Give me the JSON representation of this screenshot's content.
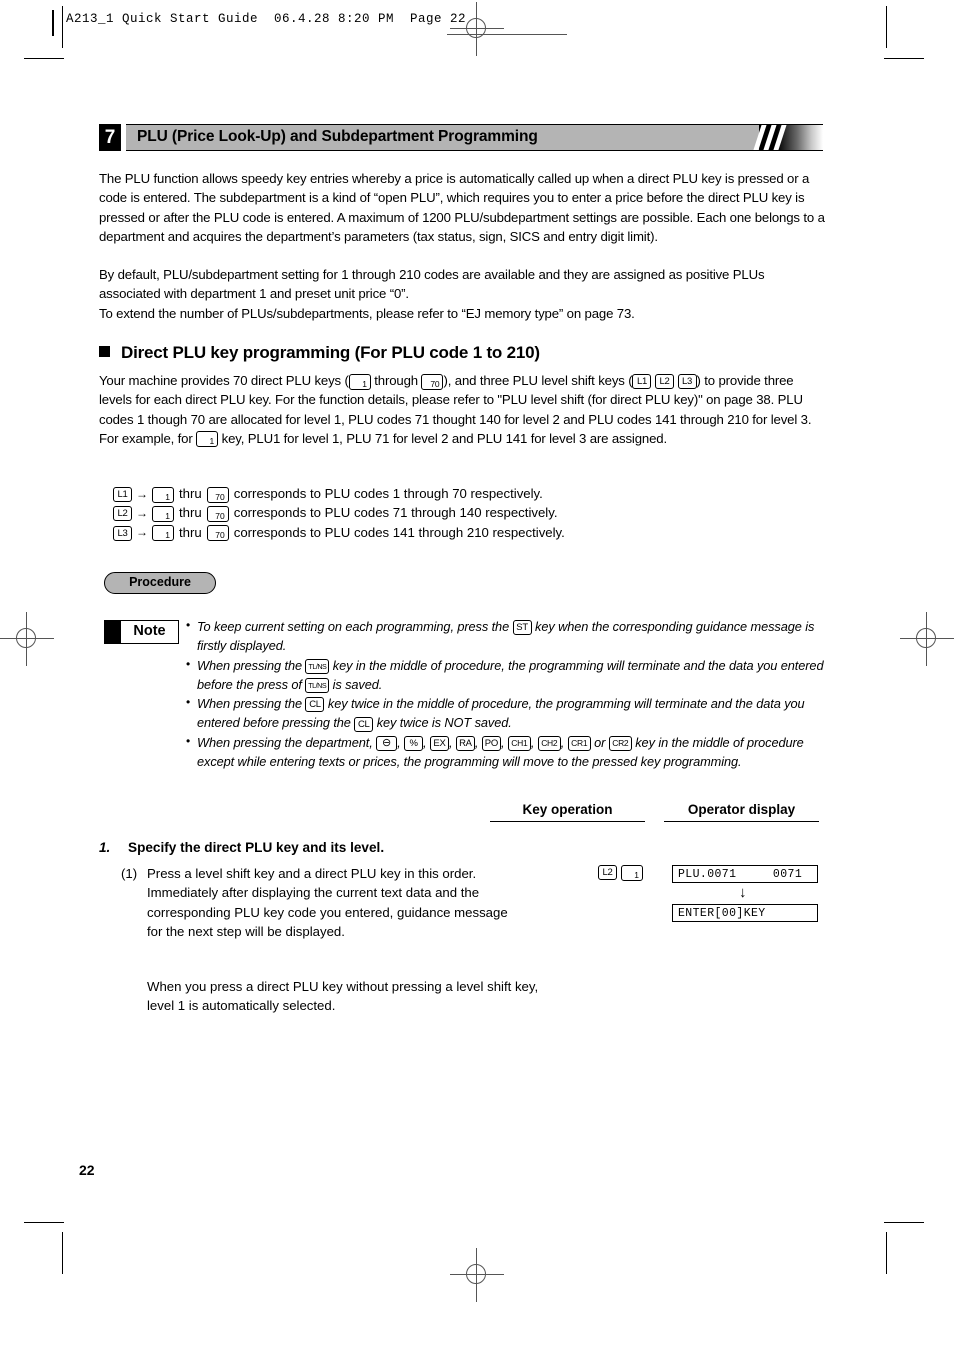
{
  "page_header": {
    "text": "A213_1 Quick Start Guide  06.4.28 8:20 PM  Page 22"
  },
  "section": {
    "number": "7",
    "title": "PLU (Price Look-Up) and Subdepartment Programming"
  },
  "intro": {
    "paragraph1": "The PLU function allows speedy key entries whereby a price is automatically called up when a direct PLU key is pressed or a code is entered.  The subdepartment is a kind of “open PLU”, which requires you to enter a price before the direct PLU key is pressed or after the PLU code is entered.  A maximum of 1200 PLU/subdepartment settings are possible. Each one belongs to a department and acquires the department’s parameters (tax status, sign, SICS and entry digit limit).",
    "paragraph2": "By default, PLU/subdepartment setting for 1 through 210 codes are available and they are assigned as positive PLUs associated with department 1 and preset unit price “0”.",
    "paragraph3": "To extend the number of PLUs/subdepartments, please refer to “EJ memory type” on page 73."
  },
  "subsection": {
    "heading": "Direct PLU key programming (For PLU code 1 to 210)",
    "body_1": "Your machine provides 70 direct PLU keys (",
    "body_2": " through ",
    "body_3": "), and three PLU level shift keys (",
    "body_4": ") to provide three levels for each direct PLU key.  For the function details, please refer to \"PLU level shift (for direct PLU key)\" on page 38.  PLU codes 1 though 70 are allocated for level 1, PLU codes 71 thought 140 for level 2 and PLU codes 141 through 210 for level 3.  For example, for ",
    "body_5": " key, PLU1 for level 1, PLU 71 for level 2 and PLU 141 for level 3 are assigned."
  },
  "keys": {
    "plu_1": "1",
    "plu_70": "70",
    "l1": "L1",
    "l2": "L2",
    "l3": "L3",
    "st": "ST",
    "tlns": "TL/NS",
    "cl": "CL",
    "minus": "⊖",
    "percent": "%",
    "ex": "EX",
    "ra": "RA",
    "po": "PO",
    "ch1": "CH1",
    "ch2": "CH2",
    "cr1": "CR1",
    "cr2": "CR2",
    "arrow": "→"
  },
  "level_rows": [
    {
      "shift": "L1",
      "from": "1",
      "thru_label": "thru",
      "to": "70",
      "text": "corresponds to PLU codes 1 through 70 respectively."
    },
    {
      "shift": "L2",
      "from": "1",
      "thru_label": "thru",
      "to": "70",
      "text": "corresponds to PLU codes 71 through 140 respectively."
    },
    {
      "shift": "L3",
      "from": "1",
      "thru_label": "thru",
      "to": "70",
      "text": "corresponds to PLU codes 141 through 210 respectively."
    }
  ],
  "procedure": {
    "label": "Procedure"
  },
  "note": {
    "label": "Note",
    "bullets": {
      "b1_a": "To keep current setting on each programming, press the ",
      "b1_b": " key when the corresponding guidance message is firstly displayed.",
      "b2_a": "When pressing the ",
      "b2_b": " key in the middle of procedure, the programming will terminate and the data you entered before the press of ",
      "b2_c": " is saved.",
      "b3_a": "When pressing the ",
      "b3_b": " key twice in the middle of procedure, the programming will terminate and the data you entered before pressing the ",
      "b3_c": " key twice is NOT saved.",
      "b4_a": "When pressing the department, ",
      "b4_sep": ", ",
      "b4_or": " or ",
      "b4_b": " key in the middle of procedure except while entering texts or prices, the programming will move to the pressed key programming."
    }
  },
  "columns": {
    "key_operation": "Key operation",
    "operator_display": "Operator display"
  },
  "step": {
    "number": "1.",
    "title": "Specify the direct PLU key and its level.",
    "substep_mark": "(1)",
    "substep_text": "Press a level shift key and a direct PLU key in this order. Immediately after displaying the current text data and the corresponding PLU key code you entered, guidance message for the next step will be displayed.",
    "tail_text": "When you press a direct PLU key without pressing a level shift key, level 1 is automatically selected.",
    "key_operation_keys": {
      "shift": "L2",
      "plu": "1"
    },
    "displays": {
      "line1": "PLU.0071     0071",
      "line2": "ENTER[00]KEY",
      "arrow": "↓"
    }
  },
  "footer": {
    "page_number": "22"
  }
}
